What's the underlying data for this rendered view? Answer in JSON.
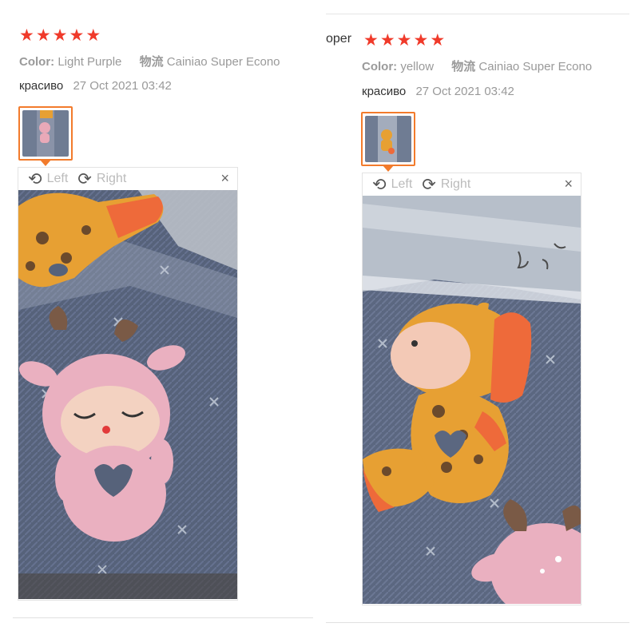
{
  "reviews": [
    {
      "stars": 5,
      "color_label": "Color:",
      "color_value": "Light Purple",
      "shipping_label": "物流",
      "shipping_value": "Cainiao Super Econo",
      "feedback": "красиво",
      "date": "27 Oct 2021 03:42",
      "viewer": {
        "left": "Left",
        "right": "Right",
        "close": "×"
      }
    },
    {
      "prefix": "oper",
      "stars": 5,
      "color_label": "Color:",
      "color_value": "yellow",
      "shipping_label": "物流",
      "shipping_value": "Cainiao Super Econo",
      "feedback": "красиво",
      "date": "27 Oct 2021 03:42",
      "viewer": {
        "left": "Left",
        "right": "Right",
        "close": "×"
      }
    }
  ],
  "colors": {
    "star": "#f03a2a",
    "thumb_border": "#f27b2c"
  },
  "icons": {
    "left": "rotate-left-icon",
    "right": "rotate-right-icon",
    "close": "close-icon"
  }
}
